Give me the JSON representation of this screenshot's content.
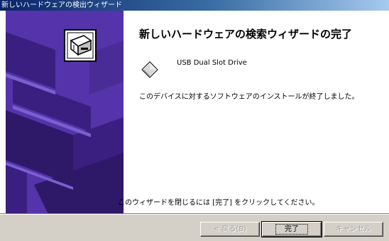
{
  "window": {
    "title": "新しいハードウェアの検出ウィザード"
  },
  "main": {
    "heading": "新しいハードウェアの検索ウィザードの完了",
    "device_name": "USB Dual Slot Drive",
    "message": "このデバイスに対するソフトウェアのインストールが終了しました。",
    "footer_instruction": "このウィザードを閉じるには [完了] をクリックしてください。"
  },
  "buttons": {
    "back": "< 戻る(B)",
    "finish": "完了",
    "cancel": "キャンセル"
  },
  "icons": {
    "sidebar_graphic": "hardware-wizard-graphic",
    "device": "usb-drive-icon"
  },
  "colors": {
    "sidebar": "#5533aa",
    "dialog_face": "#d4d0c8",
    "titlebar_start": "#0a246a"
  }
}
